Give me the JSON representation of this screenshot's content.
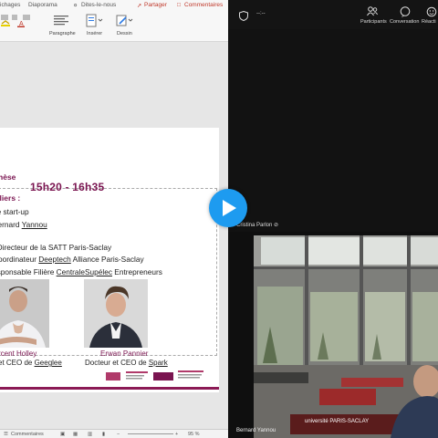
{
  "left_app": {
    "menu": [
      "ichages",
      "Diaporama",
      "Dites-le-nous",
      "Partager",
      "Commentaires"
    ],
    "ribbon_groups": [
      "Paragraphe",
      "Insérer",
      "Dessin"
    ]
  },
  "slide": {
    "title": "othèse",
    "time_range": "15h20 - 16h35",
    "ateliers_heading": "teliers :",
    "lines": [
      {
        "before": "he start-up",
        "link": "",
        "after": ""
      },
      {
        "before": "Bernard ",
        "link": "Yannou",
        "after": ""
      },
      {
        "before": ", Directeur de la SATT Paris-Saclay",
        "link": "",
        "after": ""
      },
      {
        "before": "Coordinateur ",
        "link": "Deeptech",
        "after": " Alliance Paris-Saclay"
      },
      {
        "before": "esponsable Filière ",
        "link": "CentraleSupélec",
        "after": " Entrepreneurs"
      }
    ],
    "speakers": [
      {
        "name": "rcent Holley",
        "role_before": "et CEO de ",
        "role_link": "Geeglee"
      },
      {
        "name": "Erwan Pannier",
        "role_before": "Docteur et CEO de ",
        "role_link": "Spark"
      }
    ],
    "brand_colors": {
      "accent": "#7a1450",
      "bar": "#8b1a55"
    }
  },
  "status_bar": {
    "comments": "Commentaires",
    "zoom": "95 %"
  },
  "meeting": {
    "toolbar": {
      "time": "--:--",
      "participants": "Participants",
      "conversation": "Conversation",
      "reactions": "Réacti"
    },
    "tiles": [
      {
        "name": "Cristina Parlon"
      },
      {
        "name": "Bernard Yannou"
      }
    ],
    "watermark": "université PARIS-SACLAY"
  },
  "overlay": {
    "play_icon": "play-icon",
    "accent": "#1d9bf0"
  }
}
